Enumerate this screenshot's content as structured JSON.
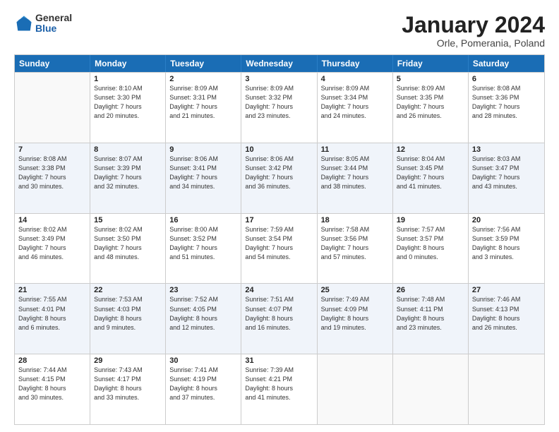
{
  "logo": {
    "general": "General",
    "blue": "Blue"
  },
  "title": {
    "month": "January 2024",
    "location": "Orle, Pomerania, Poland"
  },
  "weekdays": [
    "Sunday",
    "Monday",
    "Tuesday",
    "Wednesday",
    "Thursday",
    "Friday",
    "Saturday"
  ],
  "weeks": [
    [
      {
        "day": "",
        "sunrise": "",
        "sunset": "",
        "daylight": "",
        "empty": true
      },
      {
        "day": "1",
        "sunrise": "Sunrise: 8:10 AM",
        "sunset": "Sunset: 3:30 PM",
        "daylight": "Daylight: 7 hours and 20 minutes."
      },
      {
        "day": "2",
        "sunrise": "Sunrise: 8:09 AM",
        "sunset": "Sunset: 3:31 PM",
        "daylight": "Daylight: 7 hours and 21 minutes."
      },
      {
        "day": "3",
        "sunrise": "Sunrise: 8:09 AM",
        "sunset": "Sunset: 3:32 PM",
        "daylight": "Daylight: 7 hours and 23 minutes."
      },
      {
        "day": "4",
        "sunrise": "Sunrise: 8:09 AM",
        "sunset": "Sunset: 3:34 PM",
        "daylight": "Daylight: 7 hours and 24 minutes."
      },
      {
        "day": "5",
        "sunrise": "Sunrise: 8:09 AM",
        "sunset": "Sunset: 3:35 PM",
        "daylight": "Daylight: 7 hours and 26 minutes."
      },
      {
        "day": "6",
        "sunrise": "Sunrise: 8:08 AM",
        "sunset": "Sunset: 3:36 PM",
        "daylight": "Daylight: 7 hours and 28 minutes."
      }
    ],
    [
      {
        "day": "7",
        "sunrise": "Sunrise: 8:08 AM",
        "sunset": "Sunset: 3:38 PM",
        "daylight": "Daylight: 7 hours and 30 minutes."
      },
      {
        "day": "8",
        "sunrise": "Sunrise: 8:07 AM",
        "sunset": "Sunset: 3:39 PM",
        "daylight": "Daylight: 7 hours and 32 minutes."
      },
      {
        "day": "9",
        "sunrise": "Sunrise: 8:06 AM",
        "sunset": "Sunset: 3:41 PM",
        "daylight": "Daylight: 7 hours and 34 minutes."
      },
      {
        "day": "10",
        "sunrise": "Sunrise: 8:06 AM",
        "sunset": "Sunset: 3:42 PM",
        "daylight": "Daylight: 7 hours and 36 minutes."
      },
      {
        "day": "11",
        "sunrise": "Sunrise: 8:05 AM",
        "sunset": "Sunset: 3:44 PM",
        "daylight": "Daylight: 7 hours and 38 minutes."
      },
      {
        "day": "12",
        "sunrise": "Sunrise: 8:04 AM",
        "sunset": "Sunset: 3:45 PM",
        "daylight": "Daylight: 7 hours and 41 minutes."
      },
      {
        "day": "13",
        "sunrise": "Sunrise: 8:03 AM",
        "sunset": "Sunset: 3:47 PM",
        "daylight": "Daylight: 7 hours and 43 minutes."
      }
    ],
    [
      {
        "day": "14",
        "sunrise": "Sunrise: 8:02 AM",
        "sunset": "Sunset: 3:49 PM",
        "daylight": "Daylight: 7 hours and 46 minutes."
      },
      {
        "day": "15",
        "sunrise": "Sunrise: 8:02 AM",
        "sunset": "Sunset: 3:50 PM",
        "daylight": "Daylight: 7 hours and 48 minutes."
      },
      {
        "day": "16",
        "sunrise": "Sunrise: 8:00 AM",
        "sunset": "Sunset: 3:52 PM",
        "daylight": "Daylight: 7 hours and 51 minutes."
      },
      {
        "day": "17",
        "sunrise": "Sunrise: 7:59 AM",
        "sunset": "Sunset: 3:54 PM",
        "daylight": "Daylight: 7 hours and 54 minutes."
      },
      {
        "day": "18",
        "sunrise": "Sunrise: 7:58 AM",
        "sunset": "Sunset: 3:56 PM",
        "daylight": "Daylight: 7 hours and 57 minutes."
      },
      {
        "day": "19",
        "sunrise": "Sunrise: 7:57 AM",
        "sunset": "Sunset: 3:57 PM",
        "daylight": "Daylight: 8 hours and 0 minutes."
      },
      {
        "day": "20",
        "sunrise": "Sunrise: 7:56 AM",
        "sunset": "Sunset: 3:59 PM",
        "daylight": "Daylight: 8 hours and 3 minutes."
      }
    ],
    [
      {
        "day": "21",
        "sunrise": "Sunrise: 7:55 AM",
        "sunset": "Sunset: 4:01 PM",
        "daylight": "Daylight: 8 hours and 6 minutes."
      },
      {
        "day": "22",
        "sunrise": "Sunrise: 7:53 AM",
        "sunset": "Sunset: 4:03 PM",
        "daylight": "Daylight: 8 hours and 9 minutes."
      },
      {
        "day": "23",
        "sunrise": "Sunrise: 7:52 AM",
        "sunset": "Sunset: 4:05 PM",
        "daylight": "Daylight: 8 hours and 12 minutes."
      },
      {
        "day": "24",
        "sunrise": "Sunrise: 7:51 AM",
        "sunset": "Sunset: 4:07 PM",
        "daylight": "Daylight: 8 hours and 16 minutes."
      },
      {
        "day": "25",
        "sunrise": "Sunrise: 7:49 AM",
        "sunset": "Sunset: 4:09 PM",
        "daylight": "Daylight: 8 hours and 19 minutes."
      },
      {
        "day": "26",
        "sunrise": "Sunrise: 7:48 AM",
        "sunset": "Sunset: 4:11 PM",
        "daylight": "Daylight: 8 hours and 23 minutes."
      },
      {
        "day": "27",
        "sunrise": "Sunrise: 7:46 AM",
        "sunset": "Sunset: 4:13 PM",
        "daylight": "Daylight: 8 hours and 26 minutes."
      }
    ],
    [
      {
        "day": "28",
        "sunrise": "Sunrise: 7:44 AM",
        "sunset": "Sunset: 4:15 PM",
        "daylight": "Daylight: 8 hours and 30 minutes."
      },
      {
        "day": "29",
        "sunrise": "Sunrise: 7:43 AM",
        "sunset": "Sunset: 4:17 PM",
        "daylight": "Daylight: 8 hours and 33 minutes."
      },
      {
        "day": "30",
        "sunrise": "Sunrise: 7:41 AM",
        "sunset": "Sunset: 4:19 PM",
        "daylight": "Daylight: 8 hours and 37 minutes."
      },
      {
        "day": "31",
        "sunrise": "Sunrise: 7:39 AM",
        "sunset": "Sunset: 4:21 PM",
        "daylight": "Daylight: 8 hours and 41 minutes."
      },
      {
        "day": "",
        "sunrise": "",
        "sunset": "",
        "daylight": "",
        "empty": true
      },
      {
        "day": "",
        "sunrise": "",
        "sunset": "",
        "daylight": "",
        "empty": true
      },
      {
        "day": "",
        "sunrise": "",
        "sunset": "",
        "daylight": "",
        "empty": true
      }
    ]
  ]
}
